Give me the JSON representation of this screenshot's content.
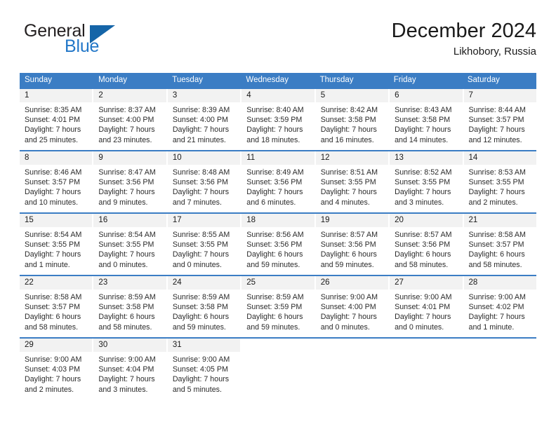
{
  "brand": {
    "name_part1": "General",
    "name_part2": "Blue",
    "accent_color": "#2277c8",
    "triangle_color": "#1565a8",
    "triangle_icon": "triangle-icon"
  },
  "header": {
    "title": "December 2024",
    "subtitle": "Likhobory, Russia"
  },
  "theme": {
    "header_blue": "#3b7dc4",
    "daynum_background": "#f2f2f2"
  },
  "weekdays": [
    "Sunday",
    "Monday",
    "Tuesday",
    "Wednesday",
    "Thursday",
    "Friday",
    "Saturday"
  ],
  "weeks": [
    [
      {
        "day": "1",
        "sunrise": "Sunrise: 8:35 AM",
        "sunset": "Sunset: 4:01 PM",
        "daylight1": "Daylight: 7 hours",
        "daylight2": "and 25 minutes."
      },
      {
        "day": "2",
        "sunrise": "Sunrise: 8:37 AM",
        "sunset": "Sunset: 4:00 PM",
        "daylight1": "Daylight: 7 hours",
        "daylight2": "and 23 minutes."
      },
      {
        "day": "3",
        "sunrise": "Sunrise: 8:39 AM",
        "sunset": "Sunset: 4:00 PM",
        "daylight1": "Daylight: 7 hours",
        "daylight2": "and 21 minutes."
      },
      {
        "day": "4",
        "sunrise": "Sunrise: 8:40 AM",
        "sunset": "Sunset: 3:59 PM",
        "daylight1": "Daylight: 7 hours",
        "daylight2": "and 18 minutes."
      },
      {
        "day": "5",
        "sunrise": "Sunrise: 8:42 AM",
        "sunset": "Sunset: 3:58 PM",
        "daylight1": "Daylight: 7 hours",
        "daylight2": "and 16 minutes."
      },
      {
        "day": "6",
        "sunrise": "Sunrise: 8:43 AM",
        "sunset": "Sunset: 3:58 PM",
        "daylight1": "Daylight: 7 hours",
        "daylight2": "and 14 minutes."
      },
      {
        "day": "7",
        "sunrise": "Sunrise: 8:44 AM",
        "sunset": "Sunset: 3:57 PM",
        "daylight1": "Daylight: 7 hours",
        "daylight2": "and 12 minutes."
      }
    ],
    [
      {
        "day": "8",
        "sunrise": "Sunrise: 8:46 AM",
        "sunset": "Sunset: 3:57 PM",
        "daylight1": "Daylight: 7 hours",
        "daylight2": "and 10 minutes."
      },
      {
        "day": "9",
        "sunrise": "Sunrise: 8:47 AM",
        "sunset": "Sunset: 3:56 PM",
        "daylight1": "Daylight: 7 hours",
        "daylight2": "and 9 minutes."
      },
      {
        "day": "10",
        "sunrise": "Sunrise: 8:48 AM",
        "sunset": "Sunset: 3:56 PM",
        "daylight1": "Daylight: 7 hours",
        "daylight2": "and 7 minutes."
      },
      {
        "day": "11",
        "sunrise": "Sunrise: 8:49 AM",
        "sunset": "Sunset: 3:56 PM",
        "daylight1": "Daylight: 7 hours",
        "daylight2": "and 6 minutes."
      },
      {
        "day": "12",
        "sunrise": "Sunrise: 8:51 AM",
        "sunset": "Sunset: 3:55 PM",
        "daylight1": "Daylight: 7 hours",
        "daylight2": "and 4 minutes."
      },
      {
        "day": "13",
        "sunrise": "Sunrise: 8:52 AM",
        "sunset": "Sunset: 3:55 PM",
        "daylight1": "Daylight: 7 hours",
        "daylight2": "and 3 minutes."
      },
      {
        "day": "14",
        "sunrise": "Sunrise: 8:53 AM",
        "sunset": "Sunset: 3:55 PM",
        "daylight1": "Daylight: 7 hours",
        "daylight2": "and 2 minutes."
      }
    ],
    [
      {
        "day": "15",
        "sunrise": "Sunrise: 8:54 AM",
        "sunset": "Sunset: 3:55 PM",
        "daylight1": "Daylight: 7 hours",
        "daylight2": "and 1 minute."
      },
      {
        "day": "16",
        "sunrise": "Sunrise: 8:54 AM",
        "sunset": "Sunset: 3:55 PM",
        "daylight1": "Daylight: 7 hours",
        "daylight2": "and 0 minutes."
      },
      {
        "day": "17",
        "sunrise": "Sunrise: 8:55 AM",
        "sunset": "Sunset: 3:55 PM",
        "daylight1": "Daylight: 7 hours",
        "daylight2": "and 0 minutes."
      },
      {
        "day": "18",
        "sunrise": "Sunrise: 8:56 AM",
        "sunset": "Sunset: 3:56 PM",
        "daylight1": "Daylight: 6 hours",
        "daylight2": "and 59 minutes."
      },
      {
        "day": "19",
        "sunrise": "Sunrise: 8:57 AM",
        "sunset": "Sunset: 3:56 PM",
        "daylight1": "Daylight: 6 hours",
        "daylight2": "and 59 minutes."
      },
      {
        "day": "20",
        "sunrise": "Sunrise: 8:57 AM",
        "sunset": "Sunset: 3:56 PM",
        "daylight1": "Daylight: 6 hours",
        "daylight2": "and 58 minutes."
      },
      {
        "day": "21",
        "sunrise": "Sunrise: 8:58 AM",
        "sunset": "Sunset: 3:57 PM",
        "daylight1": "Daylight: 6 hours",
        "daylight2": "and 58 minutes."
      }
    ],
    [
      {
        "day": "22",
        "sunrise": "Sunrise: 8:58 AM",
        "sunset": "Sunset: 3:57 PM",
        "daylight1": "Daylight: 6 hours",
        "daylight2": "and 58 minutes."
      },
      {
        "day": "23",
        "sunrise": "Sunrise: 8:59 AM",
        "sunset": "Sunset: 3:58 PM",
        "daylight1": "Daylight: 6 hours",
        "daylight2": "and 58 minutes."
      },
      {
        "day": "24",
        "sunrise": "Sunrise: 8:59 AM",
        "sunset": "Sunset: 3:58 PM",
        "daylight1": "Daylight: 6 hours",
        "daylight2": "and 59 minutes."
      },
      {
        "day": "25",
        "sunrise": "Sunrise: 8:59 AM",
        "sunset": "Sunset: 3:59 PM",
        "daylight1": "Daylight: 6 hours",
        "daylight2": "and 59 minutes."
      },
      {
        "day": "26",
        "sunrise": "Sunrise: 9:00 AM",
        "sunset": "Sunset: 4:00 PM",
        "daylight1": "Daylight: 7 hours",
        "daylight2": "and 0 minutes."
      },
      {
        "day": "27",
        "sunrise": "Sunrise: 9:00 AM",
        "sunset": "Sunset: 4:01 PM",
        "daylight1": "Daylight: 7 hours",
        "daylight2": "and 0 minutes."
      },
      {
        "day": "28",
        "sunrise": "Sunrise: 9:00 AM",
        "sunset": "Sunset: 4:02 PM",
        "daylight1": "Daylight: 7 hours",
        "daylight2": "and 1 minute."
      }
    ],
    [
      {
        "day": "29",
        "sunrise": "Sunrise: 9:00 AM",
        "sunset": "Sunset: 4:03 PM",
        "daylight1": "Daylight: 7 hours",
        "daylight2": "and 2 minutes."
      },
      {
        "day": "30",
        "sunrise": "Sunrise: 9:00 AM",
        "sunset": "Sunset: 4:04 PM",
        "daylight1": "Daylight: 7 hours",
        "daylight2": "and 3 minutes."
      },
      {
        "day": "31",
        "sunrise": "Sunrise: 9:00 AM",
        "sunset": "Sunset: 4:05 PM",
        "daylight1": "Daylight: 7 hours",
        "daylight2": "and 5 minutes."
      },
      {
        "day": "",
        "sunrise": "",
        "sunset": "",
        "daylight1": "",
        "daylight2": ""
      },
      {
        "day": "",
        "sunrise": "",
        "sunset": "",
        "daylight1": "",
        "daylight2": ""
      },
      {
        "day": "",
        "sunrise": "",
        "sunset": "",
        "daylight1": "",
        "daylight2": ""
      },
      {
        "day": "",
        "sunrise": "",
        "sunset": "",
        "daylight1": "",
        "daylight2": ""
      }
    ]
  ]
}
